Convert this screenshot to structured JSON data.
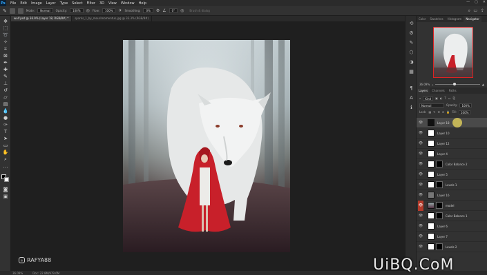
{
  "menubar": {
    "logo": "Ps",
    "items": [
      "File",
      "Edit",
      "Image",
      "Layer",
      "Type",
      "Select",
      "Filter",
      "3D",
      "View",
      "Window",
      "Help"
    ],
    "window_controls": [
      "—",
      "▢",
      "✕"
    ]
  },
  "options": {
    "mode_label": "Mode:",
    "mode_value": "Normal",
    "opacity_label": "Opacity:",
    "opacity_value": "100%",
    "flow_label": "Flow:",
    "flow_value": "100%",
    "smoothing_label": "Smoothing:",
    "smoothing_value": "0%",
    "angle_value": "0°",
    "extra": "Brush & dialog"
  },
  "tabs": [
    {
      "label": "wolf.psd @ 36.9% (Layer 18, RGB/8#) *",
      "active": true
    },
    {
      "label": "sparks_1_by_mourimomentuk.jpg @ 33.3% (RGB/8#)",
      "active": false
    }
  ],
  "canvas": {
    "badge_text": "RAFYA88"
  },
  "status": {
    "zoom": "36.09%",
    "doc": "Doc: 22.8M/979.6M"
  },
  "panel": {
    "top_tabs": [
      "Color",
      "Swatches",
      "Histogram",
      "Navigator"
    ],
    "zoom_value": "36.09%",
    "layer_tabs": [
      "Layers",
      "Channels",
      "Paths"
    ],
    "kind_label": "Kind",
    "blend_mode": "Normal",
    "opacity_label": "Opacity:",
    "opacity_value": "100%",
    "lock_label": "Lock:",
    "fill_label": "Fill:",
    "fill_value": "100%",
    "layers": [
      {
        "name": "Layer 18",
        "thumb": "dark",
        "mask": false,
        "selected": true,
        "eye": "normal"
      },
      {
        "name": "Layer 10",
        "thumb": "white",
        "mask": false,
        "selected": false,
        "eye": "normal"
      },
      {
        "name": "Layer 12",
        "thumb": "white",
        "mask": false,
        "selected": false,
        "eye": "normal"
      },
      {
        "name": "Layer 4",
        "thumb": "white",
        "mask": false,
        "selected": false,
        "eye": "normal"
      },
      {
        "name": "Color Balance 2",
        "thumb": "white",
        "mask": true,
        "selected": false,
        "eye": "normal"
      },
      {
        "name": "Layer 5",
        "thumb": "white",
        "mask": false,
        "selected": false,
        "eye": "normal"
      },
      {
        "name": "Levels 1",
        "thumb": "white",
        "mask": true,
        "selected": false,
        "eye": "normal"
      },
      {
        "name": "Layer 16",
        "thumb": "gray",
        "mask": false,
        "selected": false,
        "eye": "normal"
      },
      {
        "name": "model",
        "thumb": "photo",
        "mask": true,
        "selected": false,
        "eye": "red"
      },
      {
        "name": "Color Balance 1",
        "thumb": "white",
        "mask": true,
        "selected": false,
        "eye": "normal"
      },
      {
        "name": "Layer 6",
        "thumb": "white",
        "mask": false,
        "selected": false,
        "eye": "normal"
      },
      {
        "name": "Layer 7",
        "thumb": "white",
        "mask": false,
        "selected": false,
        "eye": "normal"
      },
      {
        "name": "Levels 2",
        "thumb": "white",
        "mask": true,
        "selected": false,
        "eye": "normal"
      }
    ]
  },
  "watermark": "UiBQ.CoM",
  "colors": {
    "accent": "#31a8ff",
    "selection_red": "#b43a2a",
    "cloak_red": "#c8202a",
    "cursor_yellow": "#d8c85a"
  }
}
